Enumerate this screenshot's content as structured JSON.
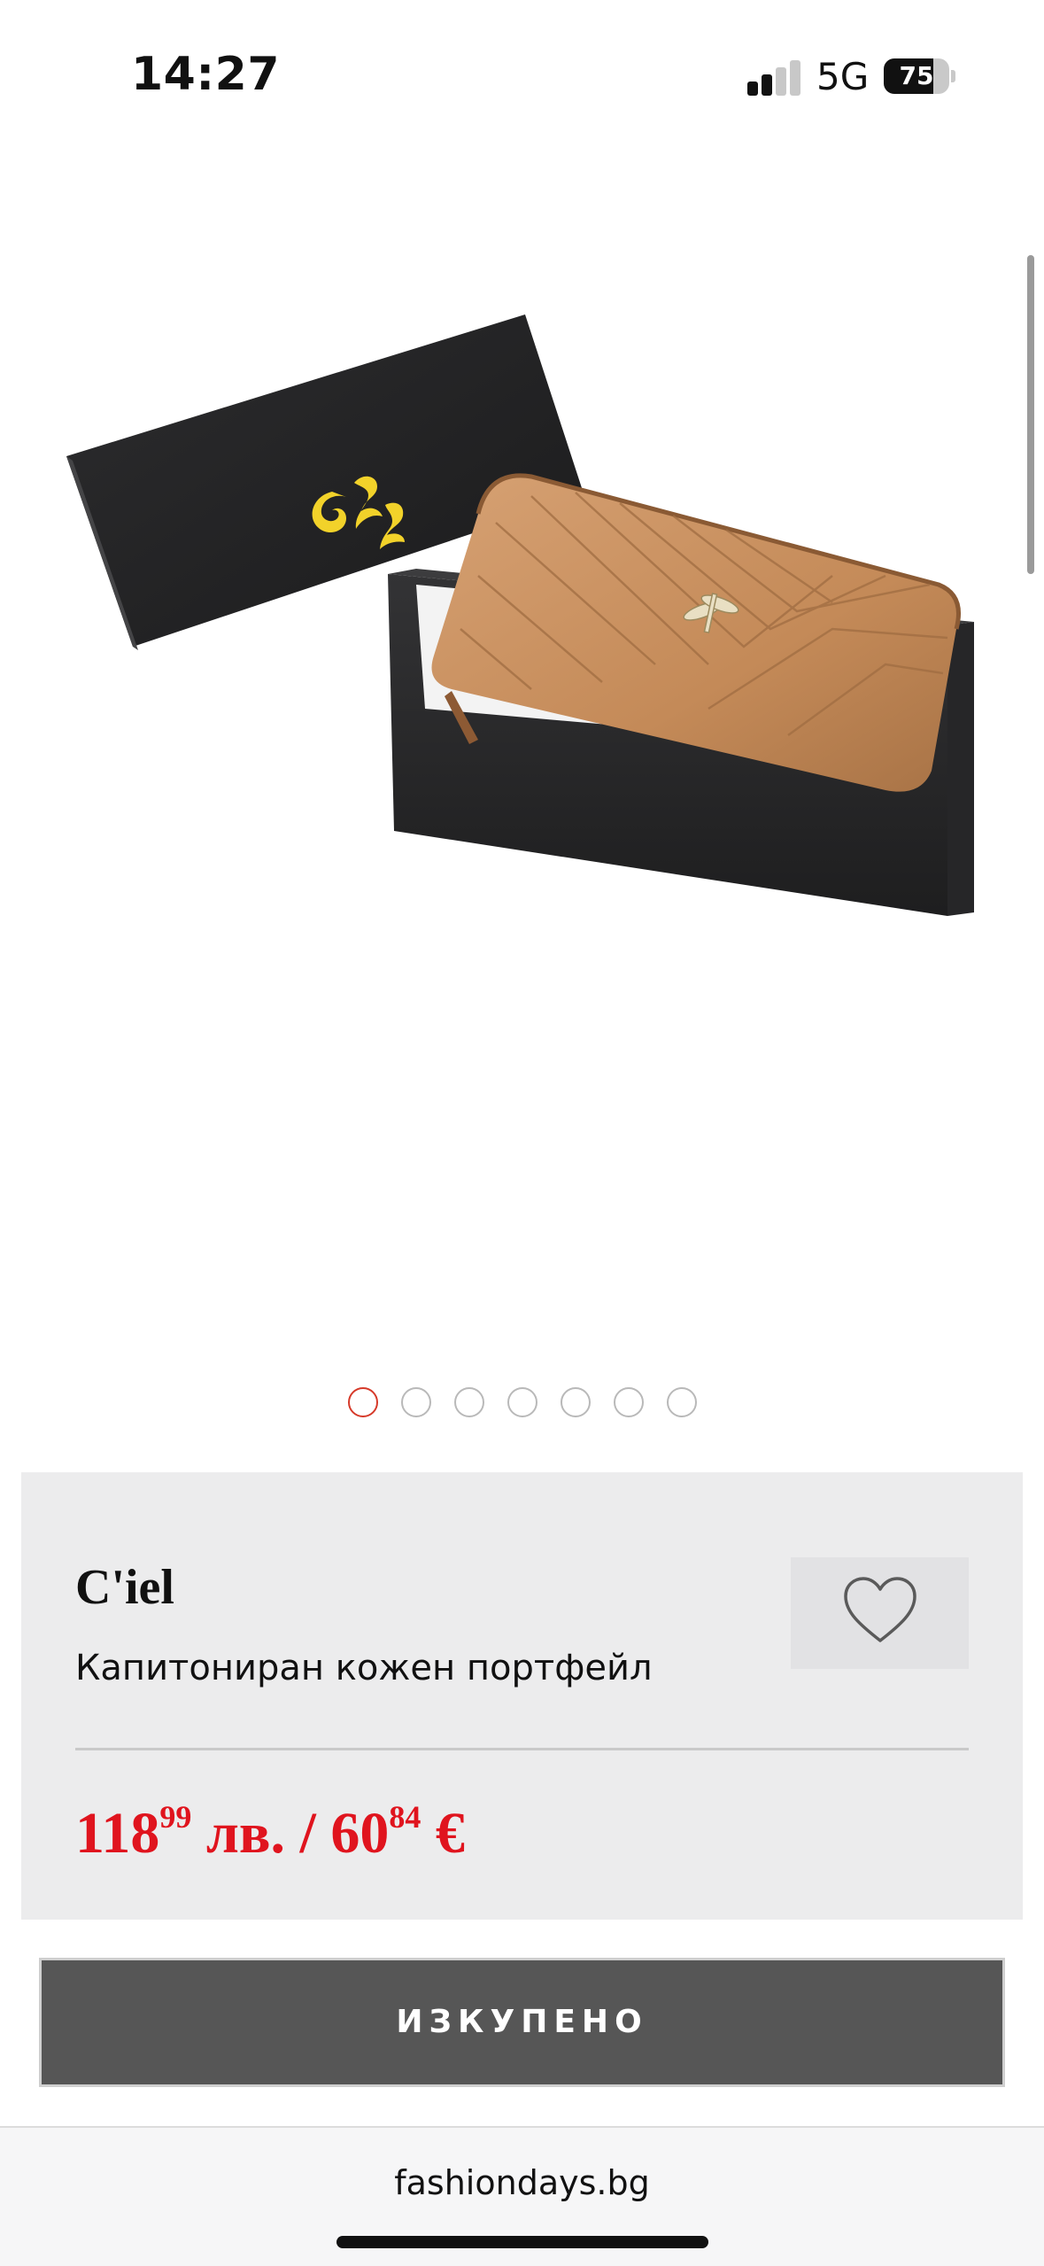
{
  "status_bar": {
    "time": "14:27",
    "network": "5G",
    "battery_percent": "75",
    "signal_bars_active": 2,
    "signal_bars_total": 4
  },
  "product": {
    "image_description_icon": "wallet-in-gift-box-image",
    "carousel": {
      "total": 7,
      "active_index": 0
    },
    "brand": "C'iel",
    "name": "Капитониран кожен портфейл",
    "price": {
      "bgn_whole": "118",
      "bgn_cents": "99",
      "bgn_currency": "лв.",
      "separator": "/",
      "eur_whole": "60",
      "eur_cents": "84",
      "eur_currency": "€"
    },
    "favorite_icon": "heart-outline-icon"
  },
  "cta": {
    "label": "ИЗКУПЕНО"
  },
  "browser": {
    "url": "fashiondays.bg"
  },
  "colors": {
    "price": "#e0141e",
    "active_dot": "#d63a2a",
    "card_bg": "#ececed",
    "button_bg": "#565656"
  }
}
